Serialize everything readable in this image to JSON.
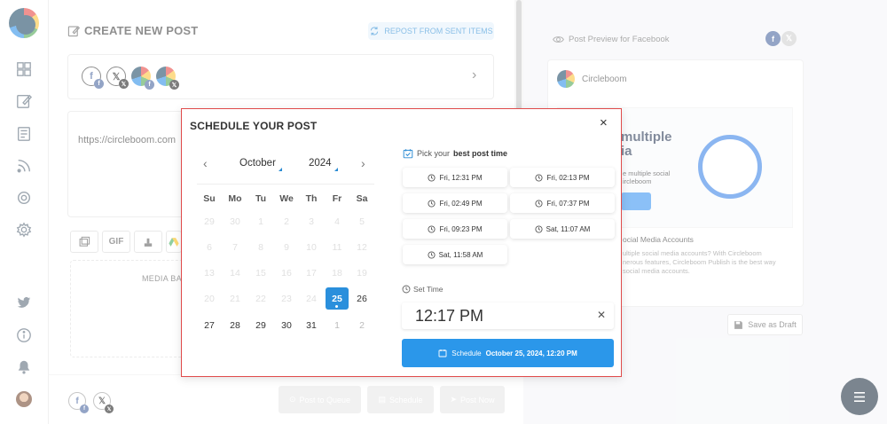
{
  "composer": {
    "title": "CREATE NEW POST",
    "repost_label": "REPOST FROM SENT ITEMS",
    "post_text": "https://circleboom.com",
    "media_label": "MEDIA BA",
    "gif_label": "GIF",
    "actions": {
      "post_to_queue": "Post to Queue",
      "schedule": "Schedule",
      "post_now": "Post Now"
    }
  },
  "preview": {
    "label": "Post Preview for Facebook",
    "account_name": "Circleboom",
    "headline_1": "multiple",
    "headline_2": "ia",
    "sub_1": "e multiple social",
    "sub_2": "ircleboom",
    "section_heading": "ocial Media Accounts",
    "desc_1": "ultiple social media accounts? With Circleboom",
    "desc_2": "nerous features, Circleboom Publish is the best way",
    "desc_3": "social media accounts.",
    "save_draft": "Save as Draft"
  },
  "modal": {
    "title": "SCHEDULE YOUR POST",
    "close_glyph": "×",
    "month": "October",
    "year": "2024",
    "prev_glyph": "‹",
    "next_glyph": "›",
    "weekdays": [
      "Su",
      "Mo",
      "Tu",
      "We",
      "Th",
      "Fr",
      "Sa"
    ],
    "weeks": [
      [
        "29",
        "30",
        "1",
        "2",
        "3",
        "4",
        "5"
      ],
      [
        "6",
        "7",
        "8",
        "9",
        "10",
        "11",
        "12"
      ],
      [
        "13",
        "14",
        "15",
        "16",
        "17",
        "18",
        "19"
      ],
      [
        "20",
        "21",
        "22",
        "23",
        "24",
        "25",
        "26"
      ],
      [
        "27",
        "28",
        "29",
        "30",
        "31",
        "1",
        "2"
      ]
    ],
    "selected_day": "25",
    "best_time_prefix": "Pick your",
    "best_time_bold": "best post time",
    "slots": [
      "Fri, 12:31 PM",
      "Fri, 02:13 PM",
      "Fri, 02:49 PM",
      "Fri, 07:37 PM",
      "Fri, 09:23 PM",
      "Sat, 11:07 AM",
      "Sat, 11:58 AM"
    ],
    "set_time_label": "Set Time",
    "time_value": "12:17 PM",
    "schedule_label": "Schedule",
    "schedule_datetime": "October 25, 2024, 12:20 PM"
  },
  "colors": {
    "accent": "#2b97ea",
    "modal_border": "#e04b4b",
    "selected_day_bg": "#2a8fdc",
    "facebook": "#3b5998",
    "fab": "#0f2233"
  }
}
